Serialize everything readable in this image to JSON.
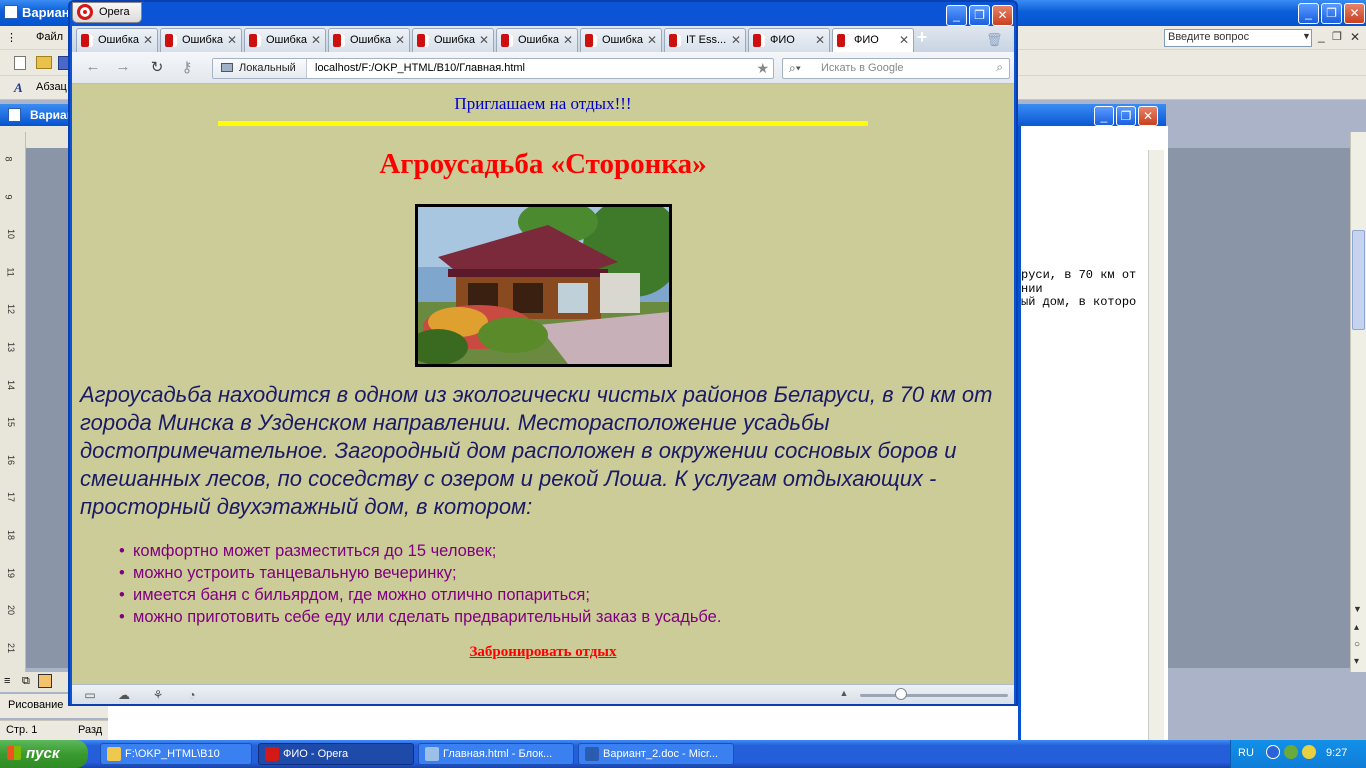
{
  "word": {
    "title": "Вариан",
    "menu_file": "Файл",
    "help_placeholder": "Введите вопрос",
    "style_box": "Абзац",
    "doc_title": "Вариан",
    "drawing": "Рисование",
    "status_page": "Стр. 1",
    "status_section": "Разд",
    "ruler_numbers": [
      "8",
      "9",
      "10",
      "11",
      "12",
      "13",
      "14",
      "15",
      "16",
      "17",
      "18",
      "19",
      "20",
      "21"
    ]
  },
  "notepad": {
    "lines": [
      "руси, в 70 км от",
      "нии",
      "ый дом, в которо"
    ]
  },
  "opera": {
    "menu_button": "Opera",
    "tabs": [
      {
        "label": "Ошибка"
      },
      {
        "label": "Ошибка"
      },
      {
        "label": "Ошибка"
      },
      {
        "label": "Ошибка"
      },
      {
        "label": "Ошибка"
      },
      {
        "label": "Ошибка"
      },
      {
        "label": "Ошибка"
      },
      {
        "label": "IT Ess..."
      },
      {
        "label": "ФИО"
      },
      {
        "label": "ФИО"
      }
    ],
    "active_tab_index": 9,
    "address_local": "Локальный",
    "url": "localhost/F:/OKP_HTML/B10/Главная.html",
    "search_placeholder": "Искать в Google"
  },
  "page": {
    "banner": "Приглашаем на отдых!!!",
    "title": "Агроусадьба «Сторонка»",
    "description": "Агроусадьба находится в одном из экологически чистых районов Беларуси, в 70 км от города Минска в Узденском направлении. Месторасположение усадьбы достопримечательное. Загородный дом расположен в окружении сосновых боров и смешанных лесов, по соседству с озером и рекой Лоша. К услугам отдыхающих - просторный двухэтажный дом, в котором:",
    "features": [
      "комфортно может разместиться до 15 человек;",
      "можно устроить танцевальную вечеринку;",
      "имеется баня с бильярдом, где можно отлично попариться;",
      "можно приготовить себе еду или сделать предварительный заказ в усадьбе."
    ],
    "book_link": "Забронировать отдых",
    "colors": {
      "background": "#cccc99",
      "banner": "#0000cc",
      "title": "#ff0000",
      "rule": "#ffff00",
      "text": "#1a1a66",
      "list": "#800080"
    }
  },
  "taskbar": {
    "start": "пуск",
    "items": [
      {
        "label": "F:\\OKP_HTML\\B10",
        "icon": "folder-icon"
      },
      {
        "label": "ФИО - Opera",
        "icon": "opera-icon"
      },
      {
        "label": "Главная.html - Блок...",
        "icon": "notepad-icon"
      },
      {
        "label": "Вариант_2.doc - Micr...",
        "icon": "word-icon"
      }
    ],
    "active_item_index": 1,
    "lang": "RU",
    "clock": "9:27"
  }
}
